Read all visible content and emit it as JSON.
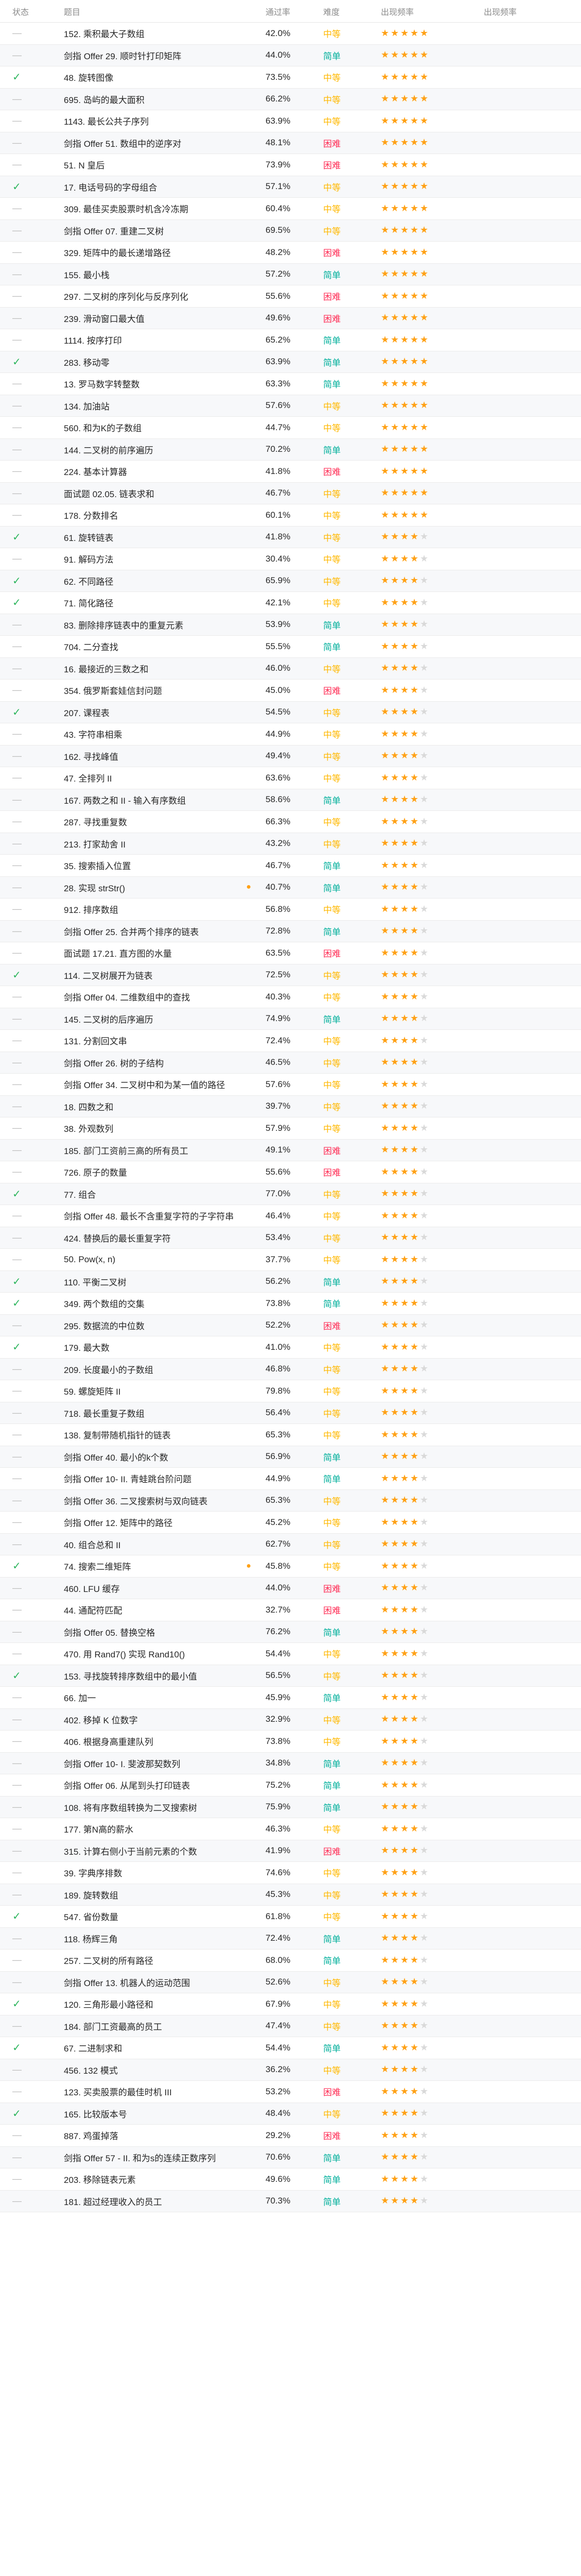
{
  "header": {
    "status": "状态",
    "title": "题目",
    "rate": "通过率",
    "difficulty": "难度",
    "frequency": "出现频率",
    "occurrence": "出现频率"
  },
  "colors": {
    "easy": "#00af9b",
    "medium": "#ffb800",
    "hard": "#ff2d55",
    "star": "#ffa116",
    "done": "#2db55d"
  },
  "rows": [
    {
      "status": "none",
      "title": "152. 乘积最大子数组",
      "rate": "42.0%",
      "difficulty": "中等",
      "diff": "medium",
      "stars": 5
    },
    {
      "status": "none",
      "title": "剑指 Offer 29. 顺时针打印矩阵",
      "rate": "44.0%",
      "difficulty": "简单",
      "diff": "easy",
      "stars": 5
    },
    {
      "status": "done",
      "title": "48. 旋转图像",
      "rate": "73.5%",
      "difficulty": "中等",
      "diff": "medium",
      "stars": 5
    },
    {
      "status": "none",
      "title": "695. 岛屿的最大面积",
      "rate": "66.2%",
      "difficulty": "中等",
      "diff": "medium",
      "stars": 5
    },
    {
      "status": "none",
      "title": "1143. 最长公共子序列",
      "rate": "63.9%",
      "difficulty": "中等",
      "diff": "medium",
      "stars": 5
    },
    {
      "status": "none",
      "title": "剑指 Offer 51. 数组中的逆序对",
      "rate": "48.1%",
      "difficulty": "困难",
      "diff": "hard",
      "stars": 5
    },
    {
      "status": "none",
      "title": "51. N 皇后",
      "rate": "73.9%",
      "difficulty": "困难",
      "diff": "hard",
      "stars": 5
    },
    {
      "status": "done",
      "title": "17. 电话号码的字母组合",
      "rate": "57.1%",
      "difficulty": "中等",
      "diff": "medium",
      "stars": 5
    },
    {
      "status": "none",
      "title": "309. 最佳买卖股票时机含冷冻期",
      "rate": "60.4%",
      "difficulty": "中等",
      "diff": "medium",
      "stars": 5
    },
    {
      "status": "none",
      "title": "剑指 Offer 07. 重建二叉树",
      "rate": "69.5%",
      "difficulty": "中等",
      "diff": "medium",
      "stars": 5
    },
    {
      "status": "none",
      "title": "329. 矩阵中的最长递增路径",
      "rate": "48.2%",
      "difficulty": "困难",
      "diff": "hard",
      "stars": 5
    },
    {
      "status": "none",
      "title": "155. 最小栈",
      "rate": "57.2%",
      "difficulty": "简单",
      "diff": "easy",
      "stars": 5
    },
    {
      "status": "none",
      "title": "297. 二叉树的序列化与反序列化",
      "rate": "55.6%",
      "difficulty": "困难",
      "diff": "hard",
      "stars": 5
    },
    {
      "status": "none",
      "title": "239. 滑动窗口最大值",
      "rate": "49.6%",
      "difficulty": "困难",
      "diff": "hard",
      "stars": 5
    },
    {
      "status": "none",
      "title": "1114. 按序打印",
      "rate": "65.2%",
      "difficulty": "简单",
      "diff": "easy",
      "stars": 5
    },
    {
      "status": "done",
      "title": "283. 移动零",
      "rate": "63.9%",
      "difficulty": "简单",
      "diff": "easy",
      "stars": 5
    },
    {
      "status": "none",
      "title": "13. 罗马数字转整数",
      "rate": "63.3%",
      "difficulty": "简单",
      "diff": "easy",
      "stars": 5
    },
    {
      "status": "none",
      "title": "134. 加油站",
      "rate": "57.6%",
      "difficulty": "中等",
      "diff": "medium",
      "stars": 5
    },
    {
      "status": "none",
      "title": "560. 和为K的子数组",
      "rate": "44.7%",
      "difficulty": "中等",
      "diff": "medium",
      "stars": 5
    },
    {
      "status": "none",
      "title": "144. 二叉树的前序遍历",
      "rate": "70.2%",
      "difficulty": "简单",
      "diff": "easy",
      "stars": 5
    },
    {
      "status": "none",
      "title": "224. 基本计算器",
      "rate": "41.8%",
      "difficulty": "困难",
      "diff": "hard",
      "stars": 5
    },
    {
      "status": "none",
      "title": "面试题 02.05. 链表求和",
      "rate": "46.7%",
      "difficulty": "中等",
      "diff": "medium",
      "stars": 5
    },
    {
      "status": "none",
      "title": "178. 分数排名",
      "rate": "60.1%",
      "difficulty": "中等",
      "diff": "medium",
      "stars": 5
    },
    {
      "status": "done",
      "title": "61. 旋转链表",
      "rate": "41.8%",
      "difficulty": "中等",
      "diff": "medium",
      "stars": 4
    },
    {
      "status": "none",
      "title": "91. 解码方法",
      "rate": "30.4%",
      "difficulty": "中等",
      "diff": "medium",
      "stars": 4
    },
    {
      "status": "done",
      "title": "62. 不同路径",
      "rate": "65.9%",
      "difficulty": "中等",
      "diff": "medium",
      "stars": 4
    },
    {
      "status": "done",
      "title": "71. 简化路径",
      "rate": "42.1%",
      "difficulty": "中等",
      "diff": "medium",
      "stars": 4
    },
    {
      "status": "none",
      "title": "83. 删除排序链表中的重复元素",
      "rate": "53.9%",
      "difficulty": "简单",
      "diff": "easy",
      "stars": 4
    },
    {
      "status": "none",
      "title": "704. 二分查找",
      "rate": "55.5%",
      "difficulty": "简单",
      "diff": "easy",
      "stars": 4
    },
    {
      "status": "none",
      "title": "16. 最接近的三数之和",
      "rate": "46.0%",
      "difficulty": "中等",
      "diff": "medium",
      "stars": 4
    },
    {
      "status": "none",
      "title": "354. 俄罗斯套娃信封问题",
      "rate": "45.0%",
      "difficulty": "困难",
      "diff": "hard",
      "stars": 4
    },
    {
      "status": "done",
      "title": "207. 课程表",
      "rate": "54.5%",
      "difficulty": "中等",
      "diff": "medium",
      "stars": 4
    },
    {
      "status": "none",
      "title": "43. 字符串相乘",
      "rate": "44.9%",
      "difficulty": "中等",
      "diff": "medium",
      "stars": 4
    },
    {
      "status": "none",
      "title": "162. 寻找峰值",
      "rate": "49.4%",
      "difficulty": "中等",
      "diff": "medium",
      "stars": 4
    },
    {
      "status": "none",
      "title": "47. 全排列 II",
      "rate": "63.6%",
      "difficulty": "中等",
      "diff": "medium",
      "stars": 4
    },
    {
      "status": "none",
      "title": "167. 两数之和 II - 输入有序数组",
      "rate": "58.6%",
      "difficulty": "简单",
      "diff": "easy",
      "stars": 4
    },
    {
      "status": "none",
      "title": "287. 寻找重复数",
      "rate": "66.3%",
      "difficulty": "中等",
      "diff": "medium",
      "stars": 4
    },
    {
      "status": "none",
      "title": "213. 打家劫舍 II",
      "rate": "43.2%",
      "difficulty": "中等",
      "diff": "medium",
      "stars": 4
    },
    {
      "status": "none",
      "title": "35. 搜索插入位置",
      "rate": "46.7%",
      "difficulty": "简单",
      "diff": "easy",
      "stars": 4
    },
    {
      "status": "none",
      "title": "28. 实现 strStr()",
      "rate": "40.7%",
      "difficulty": "简单",
      "diff": "easy",
      "stars": 4,
      "premium": true
    },
    {
      "status": "none",
      "title": "912. 排序数组",
      "rate": "56.8%",
      "difficulty": "中等",
      "diff": "medium",
      "stars": 4
    },
    {
      "status": "none",
      "title": "剑指 Offer 25. 合并两个排序的链表",
      "rate": "72.8%",
      "difficulty": "简单",
      "diff": "easy",
      "stars": 4
    },
    {
      "status": "none",
      "title": "面试题 17.21. 直方图的水量",
      "rate": "63.5%",
      "difficulty": "困难",
      "diff": "hard",
      "stars": 4
    },
    {
      "status": "done",
      "title": "114. 二叉树展开为链表",
      "rate": "72.5%",
      "difficulty": "中等",
      "diff": "medium",
      "stars": 4
    },
    {
      "status": "none",
      "title": "剑指 Offer 04. 二维数组中的查找",
      "rate": "40.3%",
      "difficulty": "中等",
      "diff": "medium",
      "stars": 4
    },
    {
      "status": "none",
      "title": "145. 二叉树的后序遍历",
      "rate": "74.9%",
      "difficulty": "简单",
      "diff": "easy",
      "stars": 4
    },
    {
      "status": "none",
      "title": "131. 分割回文串",
      "rate": "72.4%",
      "difficulty": "中等",
      "diff": "medium",
      "stars": 4
    },
    {
      "status": "none",
      "title": "剑指 Offer 26. 树的子结构",
      "rate": "46.5%",
      "difficulty": "中等",
      "diff": "medium",
      "stars": 4
    },
    {
      "status": "none",
      "title": "剑指 Offer 34. 二叉树中和为某一值的路径",
      "rate": "57.6%",
      "difficulty": "中等",
      "diff": "medium",
      "stars": 4
    },
    {
      "status": "none",
      "title": "18. 四数之和",
      "rate": "39.7%",
      "difficulty": "中等",
      "diff": "medium",
      "stars": 4
    },
    {
      "status": "none",
      "title": "38. 外观数列",
      "rate": "57.9%",
      "difficulty": "中等",
      "diff": "medium",
      "stars": 4
    },
    {
      "status": "none",
      "title": "185. 部门工资前三高的所有员工",
      "rate": "49.1%",
      "difficulty": "困难",
      "diff": "hard",
      "stars": 4
    },
    {
      "status": "none",
      "title": "726. 原子的数量",
      "rate": "55.6%",
      "difficulty": "困难",
      "diff": "hard",
      "stars": 4
    },
    {
      "status": "done",
      "title": "77. 组合",
      "rate": "77.0%",
      "difficulty": "中等",
      "diff": "medium",
      "stars": 4
    },
    {
      "status": "none",
      "title": "剑指 Offer 48. 最长不含重复字符的子字符串",
      "rate": "46.4%",
      "difficulty": "中等",
      "diff": "medium",
      "stars": 4
    },
    {
      "status": "none",
      "title": "424. 替换后的最长重复字符",
      "rate": "53.4%",
      "difficulty": "中等",
      "diff": "medium",
      "stars": 4
    },
    {
      "status": "none",
      "title": "50. Pow(x, n)",
      "rate": "37.7%",
      "difficulty": "中等",
      "diff": "medium",
      "stars": 4
    },
    {
      "status": "done",
      "title": "110. 平衡二叉树",
      "rate": "56.2%",
      "difficulty": "简单",
      "diff": "easy",
      "stars": 4
    },
    {
      "status": "done",
      "title": "349. 两个数组的交集",
      "rate": "73.8%",
      "difficulty": "简单",
      "diff": "easy",
      "stars": 4
    },
    {
      "status": "none",
      "title": "295. 数据流的中位数",
      "rate": "52.2%",
      "difficulty": "困难",
      "diff": "hard",
      "stars": 4
    },
    {
      "status": "done",
      "title": "179. 最大数",
      "rate": "41.0%",
      "difficulty": "中等",
      "diff": "medium",
      "stars": 4
    },
    {
      "status": "none",
      "title": "209. 长度最小的子数组",
      "rate": "46.8%",
      "difficulty": "中等",
      "diff": "medium",
      "stars": 4
    },
    {
      "status": "none",
      "title": "59. 螺旋矩阵 II",
      "rate": "79.8%",
      "difficulty": "中等",
      "diff": "medium",
      "stars": 4
    },
    {
      "status": "none",
      "title": "718. 最长重复子数组",
      "rate": "56.4%",
      "difficulty": "中等",
      "diff": "medium",
      "stars": 4
    },
    {
      "status": "none",
      "title": "138. 复制带随机指针的链表",
      "rate": "65.3%",
      "difficulty": "中等",
      "diff": "medium",
      "stars": 4
    },
    {
      "status": "none",
      "title": "剑指 Offer 40. 最小的k个数",
      "rate": "56.9%",
      "difficulty": "简单",
      "diff": "easy",
      "stars": 4
    },
    {
      "status": "none",
      "title": "剑指 Offer 10- II. 青蛙跳台阶问题",
      "rate": "44.9%",
      "difficulty": "简单",
      "diff": "easy",
      "stars": 4
    },
    {
      "status": "none",
      "title": "剑指 Offer 36. 二叉搜索树与双向链表",
      "rate": "65.3%",
      "difficulty": "中等",
      "diff": "medium",
      "stars": 4
    },
    {
      "status": "none",
      "title": "剑指 Offer 12. 矩阵中的路径",
      "rate": "45.2%",
      "difficulty": "中等",
      "diff": "medium",
      "stars": 4
    },
    {
      "status": "none",
      "title": "40. 组合总和 II",
      "rate": "62.7%",
      "difficulty": "中等",
      "diff": "medium",
      "stars": 4
    },
    {
      "status": "done",
      "title": "74. 搜索二维矩阵",
      "rate": "45.8%",
      "difficulty": "中等",
      "diff": "medium",
      "stars": 4,
      "premium": true
    },
    {
      "status": "none",
      "title": "460. LFU 缓存",
      "rate": "44.0%",
      "difficulty": "困难",
      "diff": "hard",
      "stars": 4
    },
    {
      "status": "none",
      "title": "44. 通配符匹配",
      "rate": "32.7%",
      "difficulty": "困难",
      "diff": "hard",
      "stars": 4
    },
    {
      "status": "none",
      "title": "剑指 Offer 05. 替换空格",
      "rate": "76.2%",
      "difficulty": "简单",
      "diff": "easy",
      "stars": 4
    },
    {
      "status": "none",
      "title": "470. 用 Rand7() 实现 Rand10()",
      "rate": "54.4%",
      "difficulty": "中等",
      "diff": "medium",
      "stars": 4
    },
    {
      "status": "done",
      "title": "153. 寻找旋转排序数组中的最小值",
      "rate": "56.5%",
      "difficulty": "中等",
      "diff": "medium",
      "stars": 4
    },
    {
      "status": "none",
      "title": "66. 加一",
      "rate": "45.9%",
      "difficulty": "简单",
      "diff": "easy",
      "stars": 4
    },
    {
      "status": "none",
      "title": "402. 移掉 K 位数字",
      "rate": "32.9%",
      "difficulty": "中等",
      "diff": "medium",
      "stars": 4
    },
    {
      "status": "none",
      "title": "406. 根据身高重建队列",
      "rate": "73.8%",
      "difficulty": "中等",
      "diff": "medium",
      "stars": 4
    },
    {
      "status": "none",
      "title": "剑指 Offer 10- I. 斐波那契数列",
      "rate": "34.8%",
      "difficulty": "简单",
      "diff": "easy",
      "stars": 4
    },
    {
      "status": "none",
      "title": "剑指 Offer 06. 从尾到头打印链表",
      "rate": "75.2%",
      "difficulty": "简单",
      "diff": "easy",
      "stars": 4
    },
    {
      "status": "none",
      "title": "108. 将有序数组转换为二叉搜索树",
      "rate": "75.9%",
      "difficulty": "简单",
      "diff": "easy",
      "stars": 4
    },
    {
      "status": "none",
      "title": "177. 第N高的薪水",
      "rate": "46.3%",
      "difficulty": "中等",
      "diff": "medium",
      "stars": 4
    },
    {
      "status": "none",
      "title": "315. 计算右侧小于当前元素的个数",
      "rate": "41.9%",
      "difficulty": "困难",
      "diff": "hard",
      "stars": 4
    },
    {
      "status": "none",
      "title": "39. 字典序排数",
      "rate": "74.6%",
      "difficulty": "中等",
      "diff": "medium",
      "stars": 4
    },
    {
      "status": "none",
      "title": "189. 旋转数组",
      "rate": "45.3%",
      "difficulty": "中等",
      "diff": "medium",
      "stars": 4
    },
    {
      "status": "done",
      "title": "547. 省份数量",
      "rate": "61.8%",
      "difficulty": "中等",
      "diff": "medium",
      "stars": 4
    },
    {
      "status": "none",
      "title": "118. 杨辉三角",
      "rate": "72.4%",
      "difficulty": "简单",
      "diff": "easy",
      "stars": 4
    },
    {
      "status": "none",
      "title": "257. 二叉树的所有路径",
      "rate": "68.0%",
      "difficulty": "简单",
      "diff": "easy",
      "stars": 4
    },
    {
      "status": "none",
      "title": "剑指 Offer 13. 机器人的运动范围",
      "rate": "52.6%",
      "difficulty": "中等",
      "diff": "medium",
      "stars": 4
    },
    {
      "status": "done",
      "title": "120. 三角形最小路径和",
      "rate": "67.9%",
      "difficulty": "中等",
      "diff": "medium",
      "stars": 4
    },
    {
      "status": "none",
      "title": "184. 部门工资最高的员工",
      "rate": "47.4%",
      "difficulty": "中等",
      "diff": "medium",
      "stars": 4
    },
    {
      "status": "done",
      "title": "67. 二进制求和",
      "rate": "54.4%",
      "difficulty": "简单",
      "diff": "easy",
      "stars": 4
    },
    {
      "status": "none",
      "title": "456. 132 模式",
      "rate": "36.2%",
      "difficulty": "中等",
      "diff": "medium",
      "stars": 4
    },
    {
      "status": "none",
      "title": "123. 买卖股票的最佳时机 III",
      "rate": "53.2%",
      "difficulty": "困难",
      "diff": "hard",
      "stars": 4
    },
    {
      "status": "done",
      "title": "165. 比较版本号",
      "rate": "48.4%",
      "difficulty": "中等",
      "diff": "medium",
      "stars": 4
    },
    {
      "status": "none",
      "title": "887. 鸡蛋掉落",
      "rate": "29.2%",
      "difficulty": "困难",
      "diff": "hard",
      "stars": 4
    },
    {
      "status": "none",
      "title": "剑指 Offer 57 - II. 和为s的连续正数序列",
      "rate": "70.6%",
      "difficulty": "简单",
      "diff": "easy",
      "stars": 4
    },
    {
      "status": "none",
      "title": "203. 移除链表元素",
      "rate": "49.6%",
      "difficulty": "简单",
      "diff": "easy",
      "stars": 4
    },
    {
      "status": "none",
      "title": "181. 超过经理收入的员工",
      "rate": "70.3%",
      "difficulty": "简单",
      "diff": "easy",
      "stars": 4
    }
  ]
}
